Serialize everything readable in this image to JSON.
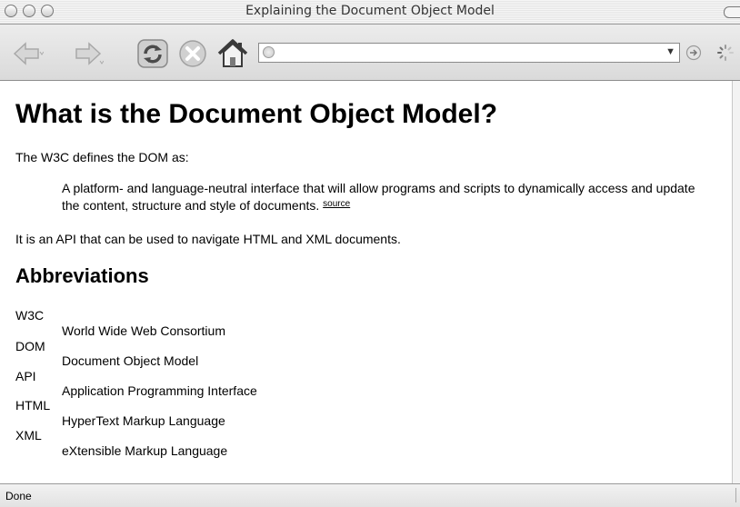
{
  "window": {
    "title": "Explaining the Document Object Model"
  },
  "toolbar": {
    "back_icon": "back-arrow-icon",
    "forward_icon": "forward-arrow-icon",
    "reload_icon": "reload-icon",
    "stop_icon": "stop-icon",
    "home_icon": "home-icon",
    "address": {
      "value": "",
      "favicon": "globe-icon"
    },
    "go_icon": "go-icon",
    "activity_icon": "spinner-icon"
  },
  "page": {
    "heading": "What is the Document Object Model?",
    "intro": "The W3C defines the DOM as:",
    "quote_text": "A platform- and language-neutral interface that will allow programs and scripts to dynamically access and update the content, structure and style of documents.",
    "quote_source_link": "source",
    "api_text": "It is an API that can be used to navigate HTML and XML documents.",
    "abbreviations_heading": "Abbreviations",
    "abbreviations": [
      {
        "term": "W3C",
        "definition": "World Wide Web Consortium"
      },
      {
        "term": "DOM",
        "definition": "Document Object Model"
      },
      {
        "term": "API",
        "definition": "Application Programming Interface"
      },
      {
        "term": "HTML",
        "definition": "HyperText Markup Language"
      },
      {
        "term": "XML",
        "definition": "eXtensible Markup Language"
      }
    ]
  },
  "status": {
    "text": "Done"
  },
  "colors": {
    "toolbar_bg": "#e2e2e2",
    "text": "#000000"
  }
}
